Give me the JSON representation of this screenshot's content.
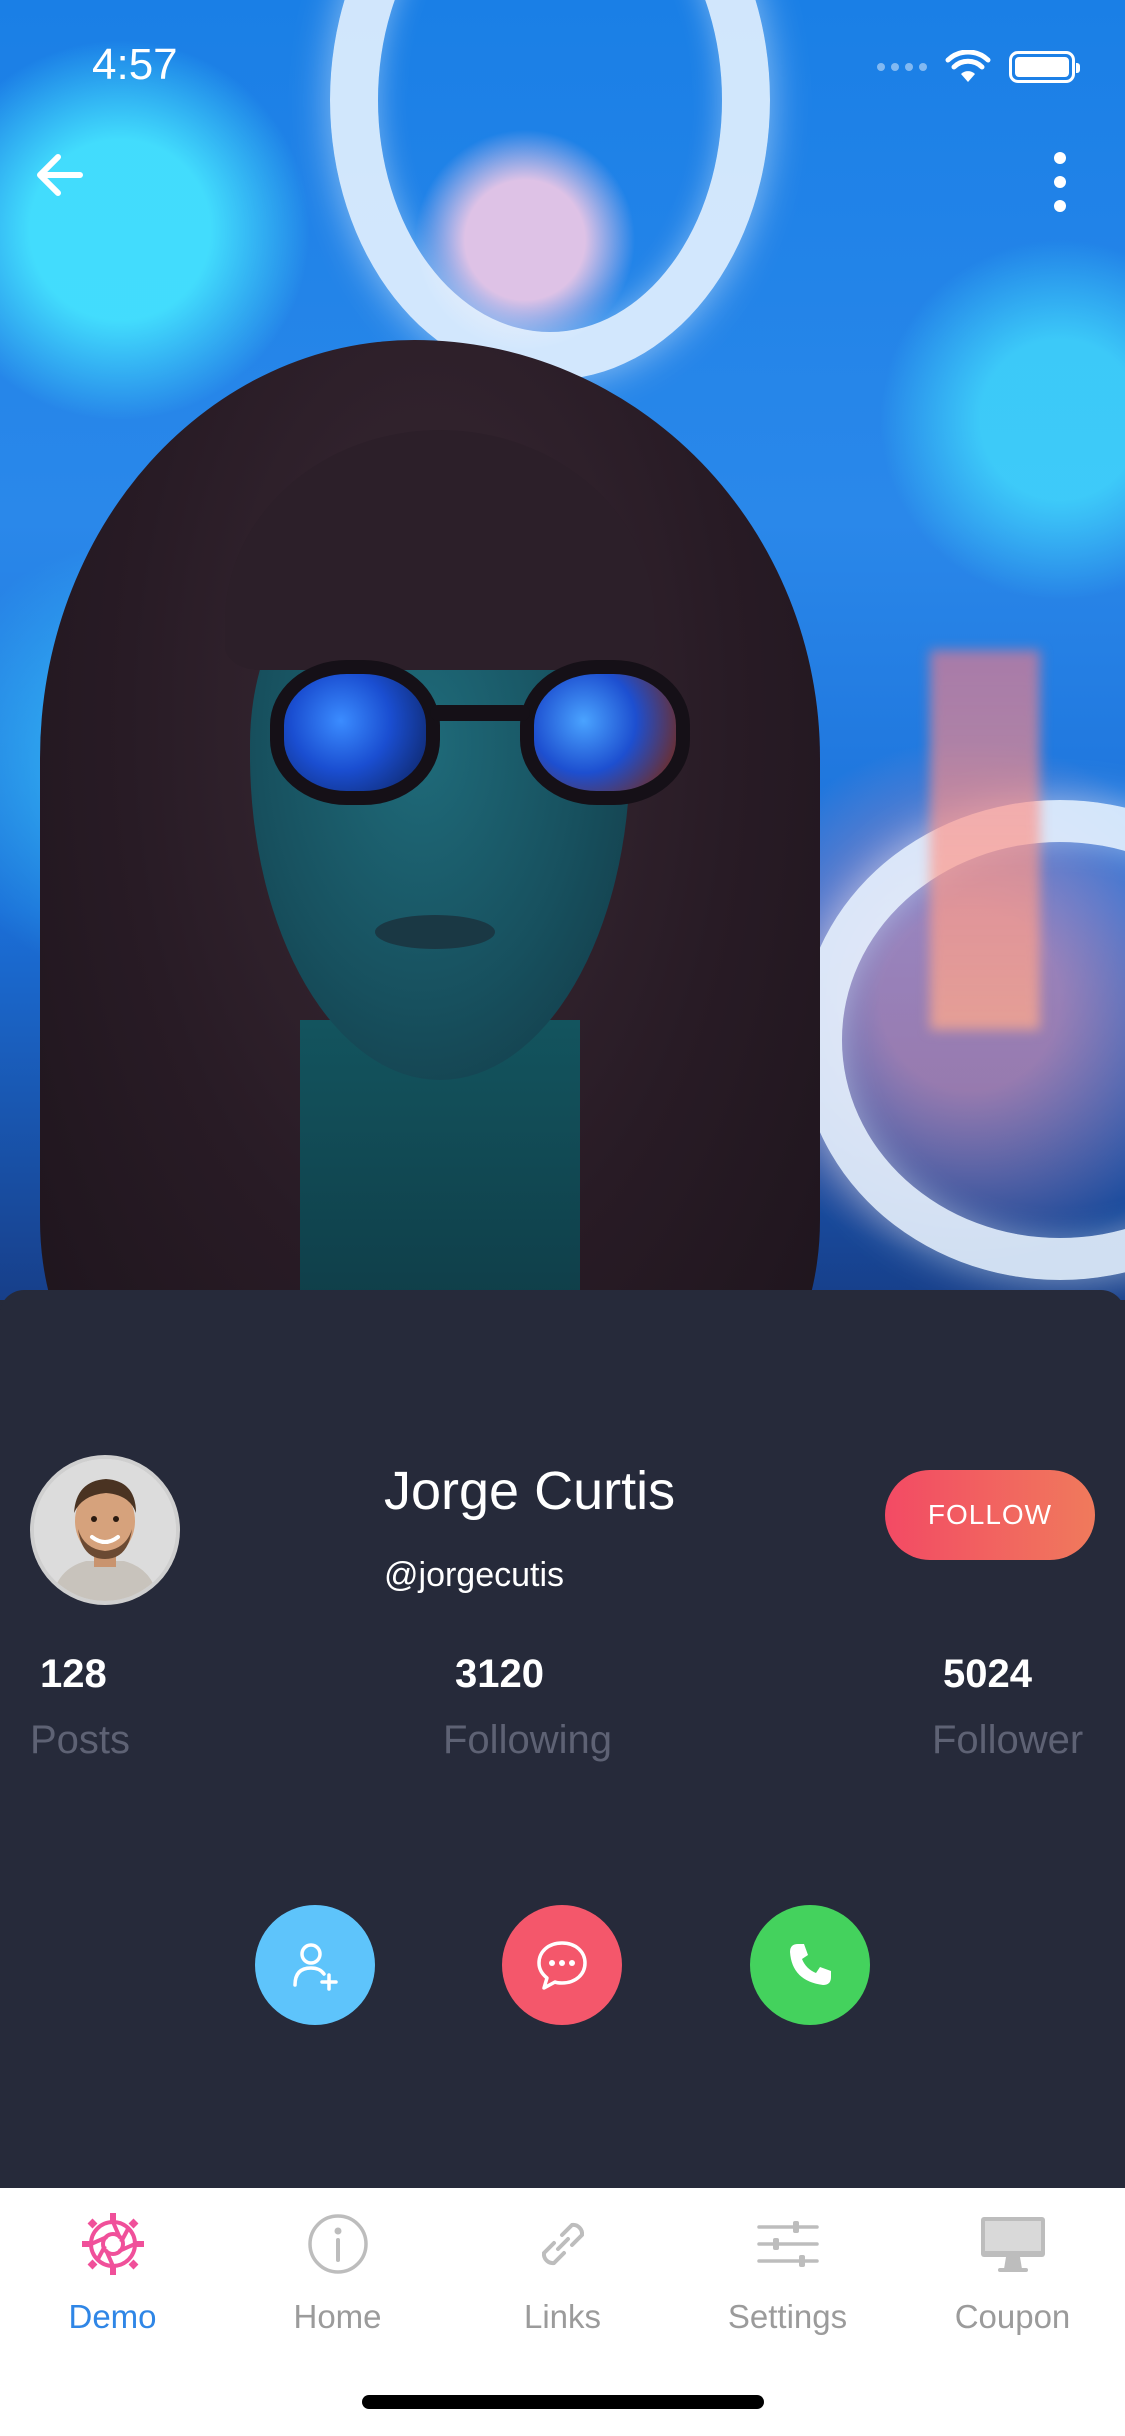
{
  "status_bar": {
    "time": "4:57"
  },
  "header": {
    "back_icon": "arrow-left-icon",
    "more_icon": "vertical-dots-icon"
  },
  "profile": {
    "name": "Jorge Curtis",
    "handle": "@jorgecutis",
    "follow_label": "FOLLOW",
    "stats": [
      {
        "value": "128",
        "label": "Posts"
      },
      {
        "value": "3120",
        "label": "Following"
      },
      {
        "value": "5024",
        "label": "Follower"
      }
    ]
  },
  "actions": [
    {
      "icon": "add-user-icon",
      "color": "#5ec4fb"
    },
    {
      "icon": "chat-bubble-icon",
      "color": "#f4576b"
    },
    {
      "icon": "phone-icon",
      "color": "#44d25d"
    }
  ],
  "tabs": [
    {
      "label": "Demo",
      "icon": "aperture-gear-icon",
      "active": true
    },
    {
      "label": "Home",
      "icon": "info-circle-icon",
      "active": false
    },
    {
      "label": "Links",
      "icon": "link-icon",
      "active": false
    },
    {
      "label": "Settings",
      "icon": "sliders-icon",
      "active": false
    },
    {
      "label": "Coupon",
      "icon": "monitor-icon",
      "active": false
    }
  ],
  "colors": {
    "card_bg": "#262a3a",
    "follow_gradient_start": "#f34a64",
    "follow_gradient_end": "#f07a5c",
    "tab_active": "#2f86e6",
    "tab_inactive": "#9b9b9b",
    "stat_label": "#5e6274"
  }
}
